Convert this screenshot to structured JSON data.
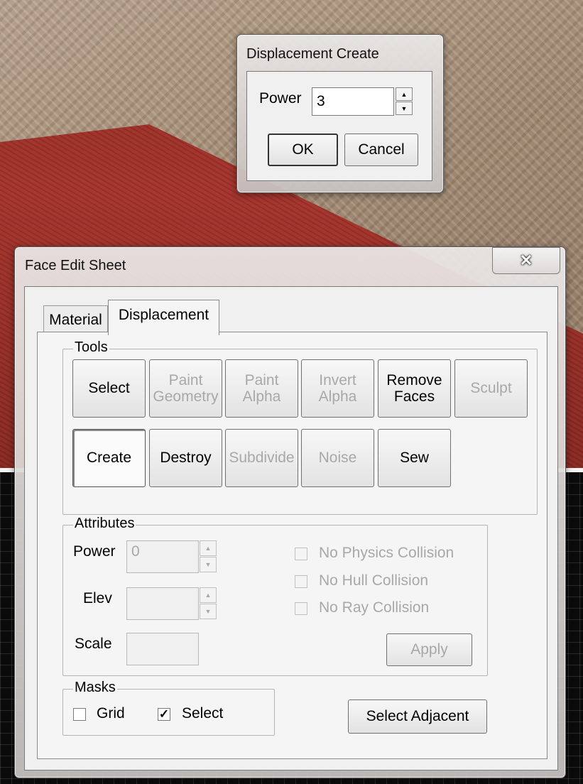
{
  "displacement_create": {
    "title": "Displacement Create",
    "power_label": "Power",
    "power_value": "3",
    "ok_label": "OK",
    "cancel_label": "Cancel"
  },
  "face_edit_sheet": {
    "title": "Face Edit Sheet",
    "close_icon": "close-icon",
    "tabs": [
      {
        "label": "Material",
        "active": false
      },
      {
        "label": "Displacement",
        "active": true
      }
    ],
    "tools": {
      "label": "Tools",
      "row1": [
        {
          "label": "Select",
          "enabled": true
        },
        {
          "label": "Paint Geometry",
          "enabled": false
        },
        {
          "label": "Paint Alpha",
          "enabled": false
        },
        {
          "label": "Invert Alpha",
          "enabled": false
        },
        {
          "label": "Remove Faces",
          "enabled": true
        },
        {
          "label": "Sculpt",
          "enabled": false
        }
      ],
      "row2": [
        {
          "label": "Create",
          "enabled": true,
          "pressed": true
        },
        {
          "label": "Destroy",
          "enabled": true
        },
        {
          "label": "Subdivide",
          "enabled": false
        },
        {
          "label": "Noise",
          "enabled": false
        },
        {
          "label": "Sew",
          "enabled": true
        }
      ]
    },
    "attributes": {
      "label": "Attributes",
      "power_label": "Power",
      "power_value": "0",
      "elev_label": "Elev",
      "elev_value": "",
      "scale_label": "Scale",
      "scale_value": "",
      "checkboxes": [
        {
          "label": "No Physics Collision",
          "checked": false,
          "enabled": false
        },
        {
          "label": "No Hull Collision",
          "checked": false,
          "enabled": false
        },
        {
          "label": "No Ray Collision",
          "checked": false,
          "enabled": false
        }
      ],
      "apply_label": "Apply"
    },
    "masks": {
      "label": "Masks",
      "grid_label": "Grid",
      "grid_checked": false,
      "select_label": "Select",
      "select_checked": true
    },
    "select_adjacent_label": "Select Adjacent"
  }
}
